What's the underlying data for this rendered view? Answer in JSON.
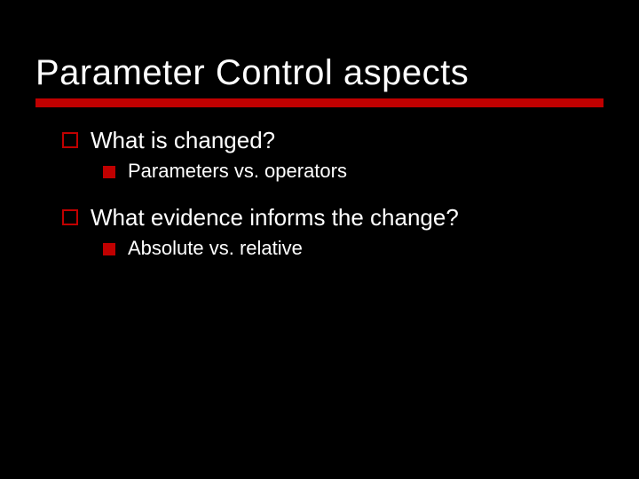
{
  "title": "Parameter Control aspects",
  "bullets": [
    {
      "text": "What is changed?",
      "children": [
        {
          "text": "Parameters vs. operators"
        }
      ]
    },
    {
      "text": "What evidence informs the change?",
      "children": [
        {
          "text": "Absolute vs. relative"
        }
      ]
    }
  ]
}
